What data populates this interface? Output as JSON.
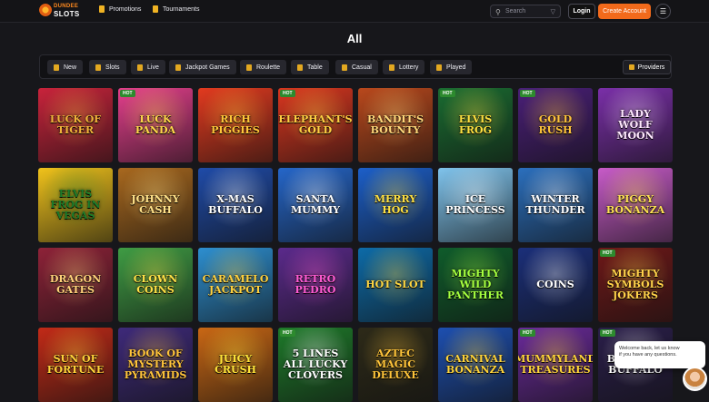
{
  "header": {
    "logo_top": "DUNDEE",
    "logo_bottom": "SLOTS",
    "nav": [
      "Promotions",
      "Tournaments"
    ],
    "search_placeholder": "Search",
    "login": "Login",
    "create_account": "Create Account"
  },
  "page_title": "All",
  "categories": [
    "New",
    "Slots",
    "Live",
    "Jackpot Games",
    "Roulette",
    "Table",
    "Casual",
    "Lottery",
    "Played"
  ],
  "providers_label": "Providers",
  "badge_label": "HOT",
  "games": [
    {
      "name": "Luck of Tiger",
      "hot": false,
      "bg": "#c8233b",
      "accent": "#f0b43a"
    },
    {
      "name": "Luck Panda",
      "hot": true,
      "bg": "#e43f8c",
      "accent": "#ffd84a"
    },
    {
      "name": "Rich Piggies",
      "hot": false,
      "bg": "#e23a1f",
      "accent": "#ffc83a"
    },
    {
      "name": "Elephant's Gold",
      "hot": true,
      "bg": "#d9361f",
      "accent": "#ffd043"
    },
    {
      "name": "Bandit's Bounty",
      "hot": false,
      "bg": "#b9481c",
      "accent": "#ffd77a"
    },
    {
      "name": "Elvis Frog",
      "hot": true,
      "bg": "#1a6c31",
      "accent": "#ffe040"
    },
    {
      "name": "Gold Rush",
      "hot": true,
      "bg": "#4a1f78",
      "accent": "#ffc43a"
    },
    {
      "name": "Lady Wolf Moon",
      "hot": false,
      "bg": "#7a2fa8",
      "accent": "#ffe8ff"
    },
    {
      "name": "Elvis Frog in Vegas",
      "hot": false,
      "bg": "#f0c21b",
      "accent": "#1c7c2b"
    },
    {
      "name": "Johnny Cash",
      "hot": false,
      "bg": "#a8681e",
      "accent": "#ffe28a"
    },
    {
      "name": "X-mas Buffalo",
      "hot": false,
      "bg": "#1f4ba8",
      "accent": "#ffffff"
    },
    {
      "name": "Santa Mummy",
      "hot": false,
      "bg": "#2566c9",
      "accent": "#ffffff"
    },
    {
      "name": "Merry Hog",
      "hot": false,
      "bg": "#1c5fc9",
      "accent": "#ffe042"
    },
    {
      "name": "Ice Princess",
      "hot": false,
      "bg": "#7fc3ec",
      "accent": "#ffffff"
    },
    {
      "name": "Winter Thunder",
      "hot": false,
      "bg": "#2b6fbd",
      "accent": "#ffffff"
    },
    {
      "name": "Piggy Bonanza",
      "hot": false,
      "bg": "#c75bc8",
      "accent": "#ffe252"
    },
    {
      "name": "Dragon Gates",
      "hot": false,
      "bg": "#8e2238",
      "accent": "#ffd27a"
    },
    {
      "name": "Clown Coins",
      "hot": false,
      "bg": "#3f9c44",
      "accent": "#ffe046"
    },
    {
      "name": "Caramelo Jackpot",
      "hot": false,
      "bg": "#2d8fd0",
      "accent": "#ffd13f"
    },
    {
      "name": "Retro Pedro",
      "hot": false,
      "bg": "#5b2a8c",
      "accent": "#ff5bd2"
    },
    {
      "name": "Hot Slot",
      "hot": false,
      "bg": "#0d6ba8",
      "accent": "#ffd743"
    },
    {
      "name": "Mighty Wild Panther",
      "hot": false,
      "bg": "#0f5c2b",
      "accent": "#a6ff3f"
    },
    {
      "name": "Coins",
      "hot": false,
      "bg": "#1b2f7a",
      "accent": "#ffffff"
    },
    {
      "name": "Mighty Symbols Jokers",
      "hot": true,
      "bg": "#6e1818",
      "accent": "#ffd24a"
    },
    {
      "name": "Sun of Fortune",
      "hot": false,
      "bg": "#c22a17",
      "accent": "#ffd23a"
    },
    {
      "name": "Book of Mystery Pyramids",
      "hot": false,
      "bg": "#3e2a7a",
      "accent": "#ffc43a"
    },
    {
      "name": "Juicy Crush",
      "hot": false,
      "bg": "#c96714",
      "accent": "#ffe43a"
    },
    {
      "name": "5 Lines All Lucky Clovers",
      "hot": true,
      "bg": "#1e7a2a",
      "accent": "#ffffff"
    },
    {
      "name": "Aztec Magic Deluxe",
      "hot": false,
      "bg": "#2d2a18",
      "accent": "#ffc43a"
    },
    {
      "name": "Carnival Bonanza",
      "hot": false,
      "bg": "#1d4fb0",
      "accent": "#ffd43a"
    },
    {
      "name": "Mummyland Treasures",
      "hot": true,
      "bg": "#6a2a9a",
      "accent": "#ffd43a"
    },
    {
      "name": "Big Wild Buffalo",
      "hot": true,
      "bg": "#2a1e4a",
      "accent": "#ffffff"
    }
  ],
  "chat_text": "Welcome back, let us know if you have any questions."
}
